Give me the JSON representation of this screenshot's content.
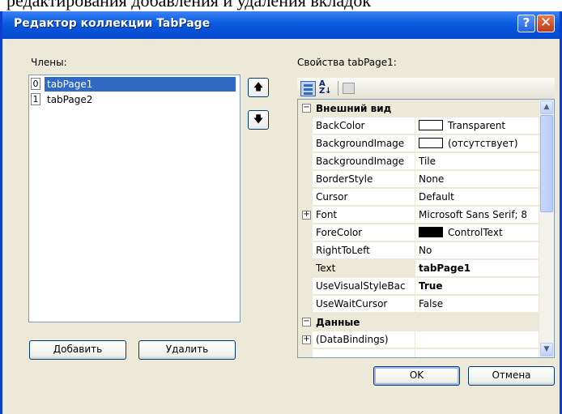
{
  "background": {
    "partial_text": "редактирования добавления и удаления вкладок"
  },
  "window": {
    "title": "Редактор коллекции TabPage",
    "help_glyph": "?",
    "close_glyph": "✕"
  },
  "members": {
    "label": "Члены:",
    "items": [
      {
        "index": "0",
        "name": "tabPage1",
        "selected": true
      },
      {
        "index": "1",
        "name": "tabPage2",
        "selected": false
      }
    ],
    "move_up_glyph": "🡅",
    "move_down_glyph": "🡇",
    "add_label": "Добавить",
    "remove_label": "Удалить"
  },
  "properties": {
    "label": "Свойства tabPage1:",
    "toolbar": {
      "categorized_icon": "categorized-icon",
      "alphabetical_icon": "alphabetical-icon",
      "property_pages_icon": "property-pages-icon"
    },
    "categories": [
      {
        "name": "Внешний вид",
        "expanded": true
      },
      {
        "name": "Данные",
        "expanded": true
      }
    ],
    "rows": [
      {
        "name": "BackColor",
        "value": "Transparent",
        "swatch": "#FFFFFF"
      },
      {
        "name": "BackgroundImage",
        "value": "(отсутствует)",
        "swatch": "#FFFFFF"
      },
      {
        "name": "BackgroundImage",
        "value": "Tile"
      },
      {
        "name": "BorderStyle",
        "value": "None"
      },
      {
        "name": "Cursor",
        "value": "Default"
      },
      {
        "name": "Font",
        "value": "Microsoft Sans Serif; 8",
        "expandable": true
      },
      {
        "name": "ForeColor",
        "value": "ControlText",
        "swatch": "#000000"
      },
      {
        "name": "RightToLeft",
        "value": "No"
      },
      {
        "name": "Text",
        "value": "tabPage1",
        "bold": true,
        "selected": true
      },
      {
        "name": "UseVisualStyleBac",
        "value": "True",
        "bold": true
      },
      {
        "name": "UseWaitCursor",
        "value": "False"
      },
      {
        "name": "(DataBindings)",
        "value": "",
        "expandable": true
      }
    ]
  },
  "buttons": {
    "ok": "OK",
    "cancel": "Отмена"
  },
  "colors": {
    "titlebar": "#0A5BE0",
    "face": "#ECE9D8",
    "selection": "#316AC5",
    "border": "#7F9DB9"
  }
}
